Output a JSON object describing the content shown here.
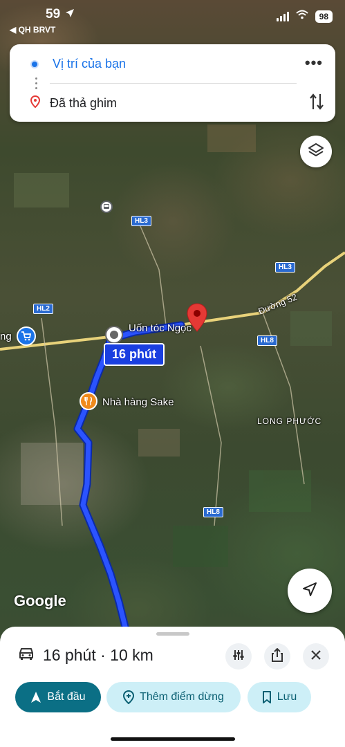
{
  "status_bar": {
    "time": "59",
    "back_label": "◀ QH BRVT",
    "battery": "98"
  },
  "directions": {
    "origin": "Vị trí của bạn",
    "destination": "Đã thả ghim"
  },
  "map": {
    "road_signs": [
      "HL3",
      "HL3",
      "HL2",
      "HL8",
      "HL8"
    ],
    "road_name": "Đường 52",
    "places": {
      "salon": "Uốn tóc Ngọc",
      "restaurant": "Nhà hàng Sake",
      "area": "LONG PHƯỚC",
      "store_fragment": "ng"
    },
    "route_time": "16 phút",
    "attribution": "Google"
  },
  "sheet": {
    "summary": "16 phút · 10 km",
    "start_label": "Bắt đầu",
    "add_stop_label": "Thêm điểm dừng",
    "save_label": "Lưu"
  },
  "colors": {
    "accent": "#1a73e8",
    "primary_button": "#0b6f85",
    "route": "#1a3fe0",
    "pin": "#e53935"
  }
}
